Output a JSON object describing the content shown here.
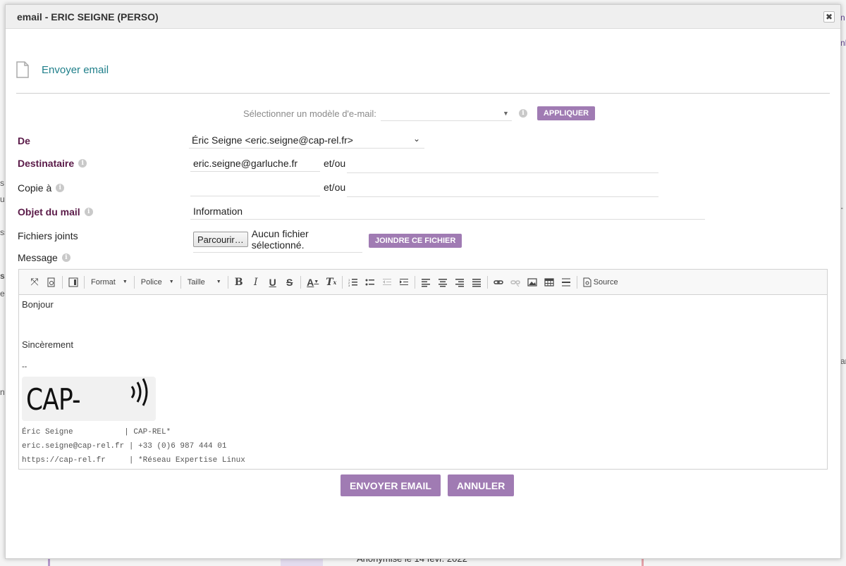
{
  "background": {
    "fragments": [
      "n",
      "nF",
      "s",
      "u",
      "ss",
      "s",
      "es",
      "ar",
      "nt",
      "-",
      "Anonymisé le 14 févr. 2022"
    ]
  },
  "modal": {
    "title": "email - ERIC SEIGNE (PERSO)",
    "close_symbol": "✖",
    "section_title": "Envoyer email",
    "template": {
      "label": "Sélectionner un modèle d'e-mail:",
      "value": "",
      "apply_label": "Appliquer"
    },
    "form": {
      "from": {
        "label": "De",
        "value": "Éric Seigne <eric.seigne@cap-rel.fr>"
      },
      "to": {
        "label": "Destinataire",
        "value": "eric.seigne@garluche.fr",
        "and_or": "et/ou",
        "extra": ""
      },
      "cc": {
        "label": "Copie à",
        "value": "",
        "and_or": "et/ou",
        "extra": ""
      },
      "subject": {
        "label": "Objet du mail",
        "value": "Information"
      },
      "attachments": {
        "label": "Fichiers joints",
        "browse_label": "Parcourir…",
        "no_file": "Aucun fichier sélectionné.",
        "attach_label": "Joindre ce fichier"
      },
      "message_label": "Message"
    },
    "editor": {
      "toolbar": {
        "format": "Format",
        "font": "Police",
        "size": "Taille",
        "source": "Source"
      },
      "body": {
        "greeting": "Bonjour",
        "closing": "Sincèrement",
        "sig_sep": "--",
        "logo_text": "CAP-REL*",
        "sig_lines": [
          "Éric Seigne           | CAP-REL*",
          "eric.seigne@cap-rel.fr | +33 (0)6 987 444 01",
          "https://cap-rel.fr     | *Réseau Expertise Linux"
        ]
      }
    },
    "actions": {
      "send_label": "Envoyer email",
      "cancel_label": "Annuler"
    }
  },
  "colors": {
    "accent": "#a07bb3",
    "title_teal": "#1f7f8a",
    "required_label": "#5a1a48"
  }
}
